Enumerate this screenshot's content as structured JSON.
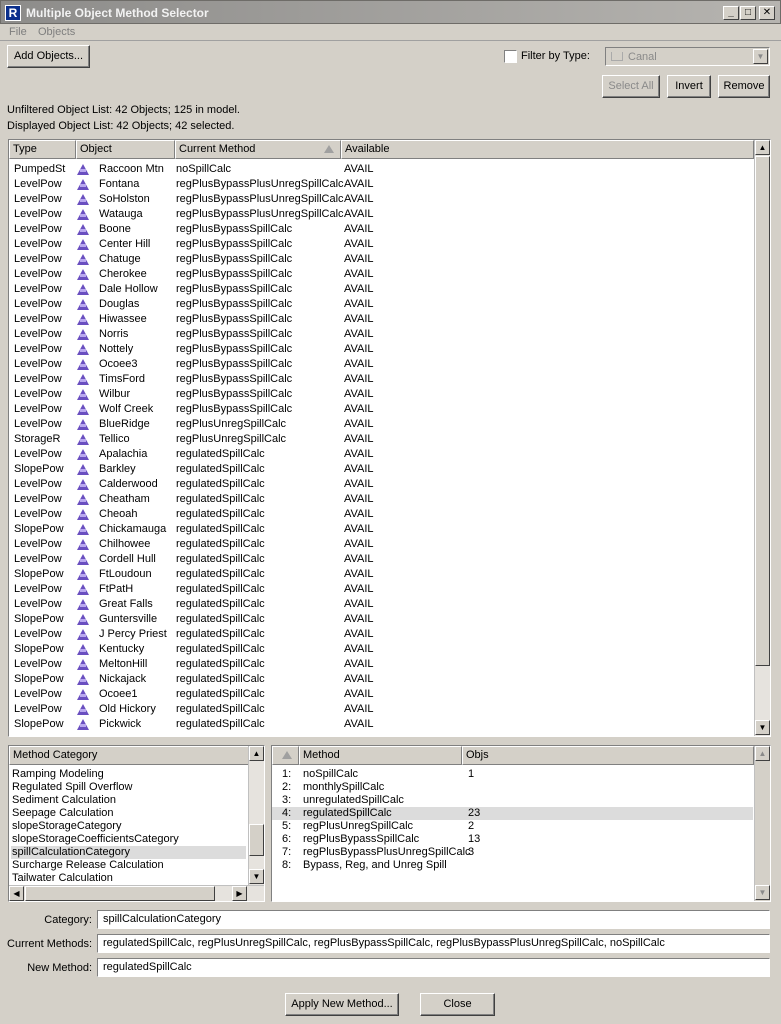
{
  "window": {
    "title": "Multiple Object Method Selector",
    "icon_letter": "R",
    "buttons": {
      "minimize": "_",
      "maximize": "□",
      "close": "✕"
    }
  },
  "menu": [
    "File",
    "Objects"
  ],
  "toolbar": {
    "add_objects": "Add Objects...",
    "filter_label": "Filter by Type:",
    "filter_checked": false,
    "filter_value": "Canal",
    "select_all": "Select All",
    "invert": "Invert",
    "remove": "Remove"
  },
  "status": {
    "unfiltered": "Unfiltered Object List:  42 Objects;  125 in model.",
    "displayed": "Displayed Object List:  42 Objects;  42 selected."
  },
  "objects_table": {
    "columns": [
      "Type",
      "Object",
      "Current Method",
      "Available"
    ],
    "rows": [
      [
        "PumpedSt",
        "Raccoon Mtn",
        "noSpillCalc",
        "AVAIL"
      ],
      [
        "LevelPow",
        "Fontana",
        "regPlusBypassPlusUnregSpillCalc",
        "AVAIL"
      ],
      [
        "LevelPow",
        "SoHolston",
        "regPlusBypassPlusUnregSpillCalc",
        "AVAIL"
      ],
      [
        "LevelPow",
        "Watauga",
        "regPlusBypassPlusUnregSpillCalc",
        "AVAIL"
      ],
      [
        "LevelPow",
        "Boone",
        "regPlusBypassSpillCalc",
        "AVAIL"
      ],
      [
        "LevelPow",
        "Center Hill",
        "regPlusBypassSpillCalc",
        "AVAIL"
      ],
      [
        "LevelPow",
        "Chatuge",
        "regPlusBypassSpillCalc",
        "AVAIL"
      ],
      [
        "LevelPow",
        "Cherokee",
        "regPlusBypassSpillCalc",
        "AVAIL"
      ],
      [
        "LevelPow",
        "Dale Hollow",
        "regPlusBypassSpillCalc",
        "AVAIL"
      ],
      [
        "LevelPow",
        "Douglas",
        "regPlusBypassSpillCalc",
        "AVAIL"
      ],
      [
        "LevelPow",
        "Hiwassee",
        "regPlusBypassSpillCalc",
        "AVAIL"
      ],
      [
        "LevelPow",
        "Norris",
        "regPlusBypassSpillCalc",
        "AVAIL"
      ],
      [
        "LevelPow",
        "Nottely",
        "regPlusBypassSpillCalc",
        "AVAIL"
      ],
      [
        "LevelPow",
        "Ocoee3",
        "regPlusBypassSpillCalc",
        "AVAIL"
      ],
      [
        "LevelPow",
        "TimsFord",
        "regPlusBypassSpillCalc",
        "AVAIL"
      ],
      [
        "LevelPow",
        "Wilbur",
        "regPlusBypassSpillCalc",
        "AVAIL"
      ],
      [
        "LevelPow",
        "Wolf Creek",
        "regPlusBypassSpillCalc",
        "AVAIL"
      ],
      [
        "LevelPow",
        "BlueRidge",
        "regPlusUnregSpillCalc",
        "AVAIL"
      ],
      [
        "StorageR",
        "Tellico",
        "regPlusUnregSpillCalc",
        "AVAIL"
      ],
      [
        "LevelPow",
        "Apalachia",
        "regulatedSpillCalc",
        "AVAIL"
      ],
      [
        "SlopePow",
        "Barkley",
        "regulatedSpillCalc",
        "AVAIL"
      ],
      [
        "LevelPow",
        "Calderwood",
        "regulatedSpillCalc",
        "AVAIL"
      ],
      [
        "LevelPow",
        "Cheatham",
        "regulatedSpillCalc",
        "AVAIL"
      ],
      [
        "LevelPow",
        "Cheoah",
        "regulatedSpillCalc",
        "AVAIL"
      ],
      [
        "SlopePow",
        "Chickamauga",
        "regulatedSpillCalc",
        "AVAIL"
      ],
      [
        "LevelPow",
        "Chilhowee",
        "regulatedSpillCalc",
        "AVAIL"
      ],
      [
        "LevelPow",
        "Cordell Hull",
        "regulatedSpillCalc",
        "AVAIL"
      ],
      [
        "SlopePow",
        "FtLoudoun",
        "regulatedSpillCalc",
        "AVAIL"
      ],
      [
        "LevelPow",
        "FtPatH",
        "regulatedSpillCalc",
        "AVAIL"
      ],
      [
        "LevelPow",
        "Great Falls",
        "regulatedSpillCalc",
        "AVAIL"
      ],
      [
        "SlopePow",
        "Guntersville",
        "regulatedSpillCalc",
        "AVAIL"
      ],
      [
        "LevelPow",
        "J Percy Priest",
        "regulatedSpillCalc",
        "AVAIL"
      ],
      [
        "SlopePow",
        "Kentucky",
        "regulatedSpillCalc",
        "AVAIL"
      ],
      [
        "LevelPow",
        "MeltonHill",
        "regulatedSpillCalc",
        "AVAIL"
      ],
      [
        "SlopePow",
        "Nickajack",
        "regulatedSpillCalc",
        "AVAIL"
      ],
      [
        "LevelPow",
        "Ocoee1",
        "regulatedSpillCalc",
        "AVAIL"
      ],
      [
        "LevelPow",
        "Old Hickory",
        "regulatedSpillCalc",
        "AVAIL"
      ],
      [
        "SlopePow",
        "Pickwick",
        "regulatedSpillCalc",
        "AVAIL"
      ]
    ]
  },
  "category_list": {
    "header": "Method Category",
    "items": [
      "Ramping Modeling",
      "Regulated Spill Overflow",
      "Sediment Calculation",
      "Seepage Calculation",
      "slopeStorageCategory",
      "slopeStorageCoefficientsCategory",
      "spillCalculationCategory",
      "Surcharge Release Calculation",
      "Tailwater Calculation"
    ],
    "selected_index": 6
  },
  "method_table": {
    "columns": [
      "Method",
      "Objs"
    ],
    "rows": [
      [
        "1:",
        "noSpillCalc",
        "1"
      ],
      [
        "2:",
        "monthlySpillCalc",
        ""
      ],
      [
        "3:",
        "unregulatedSpillCalc",
        ""
      ],
      [
        "4:",
        "regulatedSpillCalc",
        "23"
      ],
      [
        "5:",
        "regPlusUnregSpillCalc",
        "2"
      ],
      [
        "6:",
        "regPlusBypassSpillCalc",
        "13"
      ],
      [
        "7:",
        "regPlusBypassPlusUnregSpillCalc",
        "3"
      ],
      [
        "8:",
        "Bypass, Reg, and Unreg Spill",
        ""
      ]
    ],
    "selected_index": 3
  },
  "fields": {
    "category_label": "Category:",
    "category_value": "spillCalculationCategory",
    "current_label": "Current Methods:",
    "current_value": "regulatedSpillCalc, regPlusUnregSpillCalc, regPlusBypassSpillCalc, regPlusBypassPlusUnregSpillCalc, noSpillCalc",
    "new_label": "New Method:",
    "new_value": "regulatedSpillCalc"
  },
  "footer": {
    "apply": "Apply New Method...",
    "close": "Close"
  }
}
